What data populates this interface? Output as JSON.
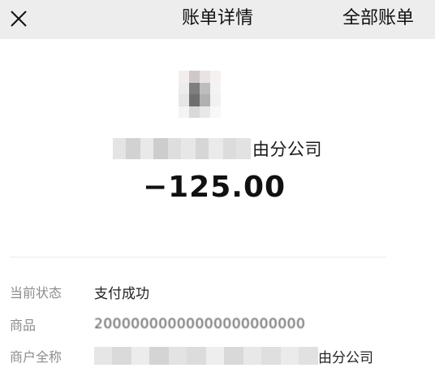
{
  "nav": {
    "close_icon": "close-icon",
    "title": "账单详情",
    "right_label": "全部账单"
  },
  "merchant": {
    "name_visible_suffix": "由分公司"
  },
  "amount": "−125.00",
  "details": [
    {
      "label": "当前状态",
      "value": "支付成功"
    },
    {
      "label": "商品",
      "value": "20000000000000000000000"
    },
    {
      "label": "商户全称",
      "value_suffix": "由分公司"
    }
  ],
  "colors": {
    "nav_bg": "#ededed",
    "label": "#8c8c8c",
    "text": "#111111"
  }
}
